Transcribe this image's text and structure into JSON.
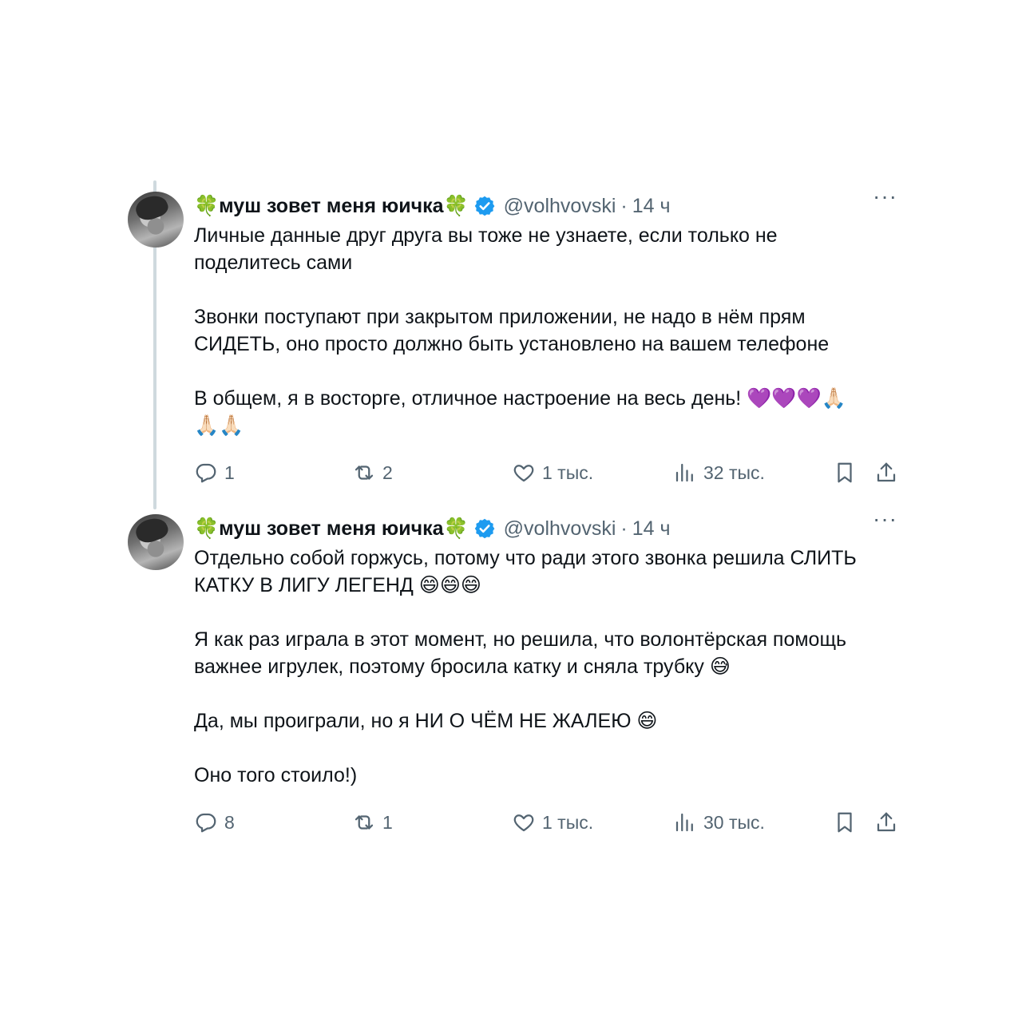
{
  "tweets": [
    {
      "author": "🍀муш зовет меня юичка🍀",
      "handle": "@volhvovski",
      "separator": "·",
      "time": "14 ч",
      "more": "···",
      "text": "Личные данные друг друга вы тоже не узнаете, если только не\nподелитесь сами\n\nЗвонки поступают при закрытом приложении, не надо в нём прям\nСИДЕТЬ, оно просто должно быть установлено на вашем телефоне\n\nВ общем, я в восторге, отличное настроение на весь день! 💜💜💜🙏🏻\n🙏🏻🙏🏻",
      "replies": "1",
      "reposts": "2",
      "likes": "1 тыс.",
      "views": "32 тыс."
    },
    {
      "author": "🍀муш зовет меня юичка🍀",
      "handle": "@volhvovski",
      "separator": "·",
      "time": "14 ч",
      "more": "···",
      "text": "Отдельно собой горжусь, потому что ради этого звонка решила СЛИТЬ\nКАТКУ В ЛИГУ ЛЕГЕНД 😄😄😄\n\nЯ как раз играла в этот момент, но решила, что волонтёрская помощь\nважнее игрулек, поэтому бросила катку и сняла трубку 😅\n\nДа, мы проиграли, но я НИ О ЧЁМ НЕ ЖАЛЕЮ 😄\n\nОно того стоило!)",
      "replies": "8",
      "reposts": "1",
      "likes": "1 тыс.",
      "views": "30 тыс."
    }
  ],
  "colors": {
    "text": "#0f1419",
    "secondary": "#536471",
    "verified": "#1d9bf0",
    "thread_line": "#cfd9de"
  },
  "icons": [
    "reply-icon",
    "repost-icon",
    "like-icon",
    "views-icon",
    "bookmark-icon",
    "share-icon",
    "verified-badge-icon",
    "more-icon"
  ]
}
